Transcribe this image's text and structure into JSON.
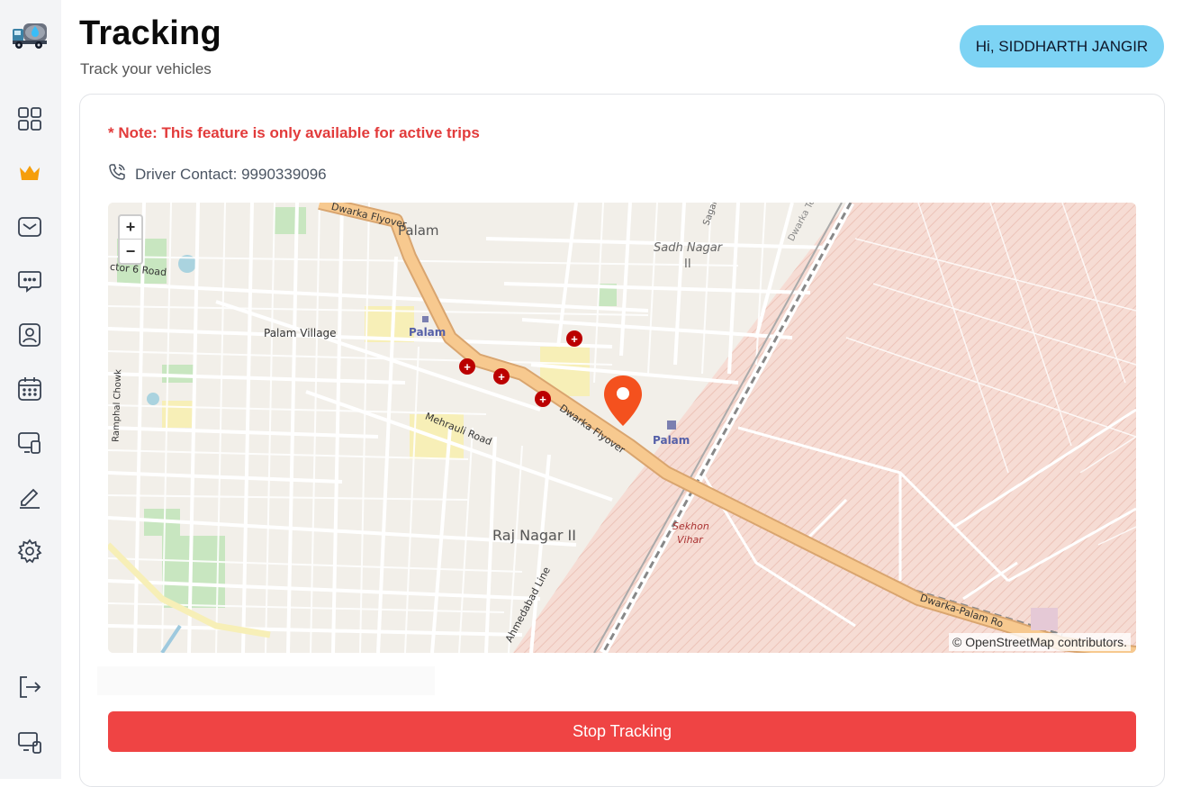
{
  "page": {
    "title": "Tracking",
    "subtitle": "Track your vehicles"
  },
  "user": {
    "greeting": "Hi, SIDDHARTH JANGIR"
  },
  "sidebar": {
    "items": [
      {
        "icon": "dashboard-grid-icon"
      },
      {
        "icon": "crown-icon",
        "active": true,
        "color": "#f59e0b"
      },
      {
        "icon": "mail-icon"
      },
      {
        "icon": "chat-icon"
      },
      {
        "icon": "user-profile-icon"
      },
      {
        "icon": "calendar-icon"
      },
      {
        "icon": "devices-icon"
      },
      {
        "icon": "edit-pencil-icon"
      },
      {
        "icon": "settings-gear-icon"
      }
    ],
    "bottom_items": [
      {
        "icon": "logout-icon"
      },
      {
        "icon": "device-switch-icon"
      }
    ]
  },
  "tracking": {
    "note": "* Note: This feature is only available for active trips",
    "driver_contact_label": "Driver Contact: 9990339096",
    "stop_button": "Stop Tracking"
  },
  "map": {
    "zoom_in": "+",
    "zoom_out": "−",
    "attribution": "© OpenStreetMap contributors.",
    "labels": {
      "palam": "Palam",
      "sadh_nagar": "Sadh Nagar",
      "sadh_nagar_ii": "II",
      "palam_village": "Palam Village",
      "palam_station_1": "Palam",
      "palam_station_2": "Palam",
      "sector6": "ctor 6 Road",
      "dwarka_flyover_top": "Dwarka Flyover",
      "dwarka_flyover": "Dwarka Flyover",
      "mehrauli": "Mehrauli Road",
      "raj_nagar": "Raj Nagar II",
      "sekhon": "Sekhon",
      "vihar": "Vihar",
      "ramphal": "Ramphal Chowk",
      "ahmedabad": "Ahmedabad Line",
      "dwarka_palam": "Dwarka-Palam Ro",
      "sagar": "Sagar",
      "dwarka_te": "Dwarka Te",
      "sadh_nagar_2": "Sadh Nagar"
    },
    "colors": {
      "road_major": "#f7c98f",
      "military": "#f3d6d0",
      "land": "#f2efe9",
      "pin": "#f4511e"
    }
  },
  "colors": {
    "accent_red": "#ef4444",
    "pill_blue": "#7dd3f4"
  }
}
